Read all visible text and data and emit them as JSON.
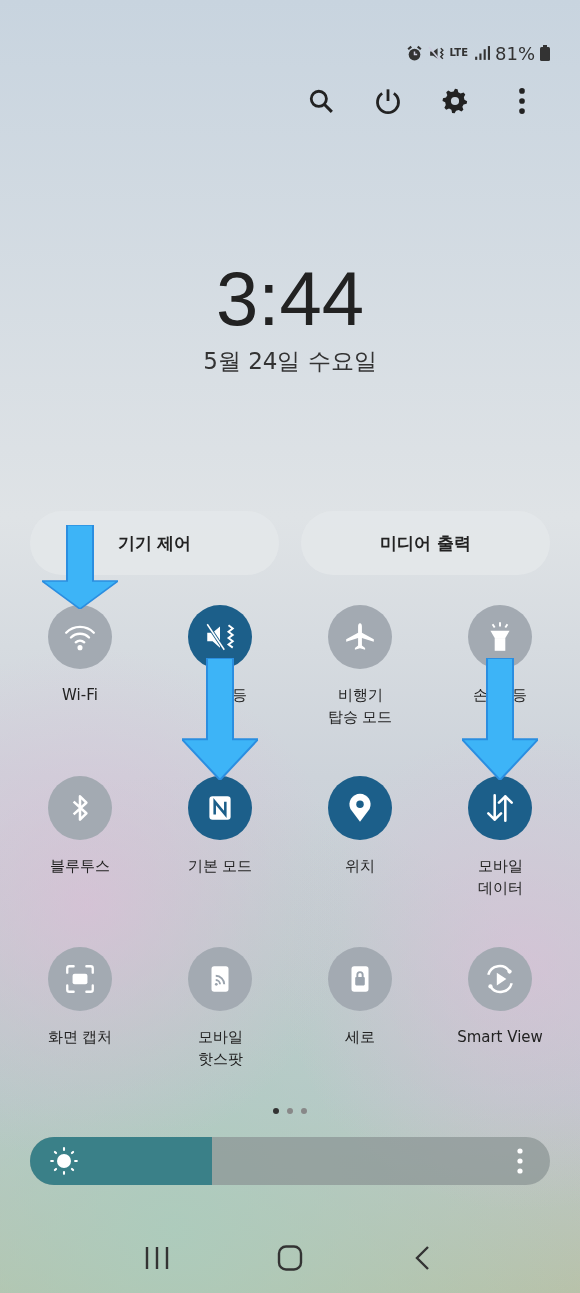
{
  "status_bar": {
    "network": "LTE",
    "battery": "81%"
  },
  "clock": {
    "time": "3:44",
    "date": "5월 24일 수요일"
  },
  "panel_buttons": [
    {
      "label": "기기 제어"
    },
    {
      "label": "미디어 출력"
    }
  ],
  "tiles": [
    {
      "label_lines": [
        "Wi-Fi"
      ],
      "on": false,
      "arrow_marked": true
    },
    {
      "fragments": [
        "등"
      ],
      "on": true,
      "arrow_marked": false
    },
    {
      "label_lines": [
        "비행기",
        "탑승 모드"
      ],
      "on": false,
      "arrow_marked": false
    },
    {
      "fragments": [
        "손",
        "등"
      ],
      "on": false,
      "arrow_marked": false
    },
    {
      "label_lines": [
        "블루투스"
      ],
      "on": false,
      "arrow_marked": false
    },
    {
      "label_lines": [
        "기본 모드"
      ],
      "on": true,
      "arrow_marked": true
    },
    {
      "label_lines": [
        "위치"
      ],
      "on": true,
      "arrow_marked": false
    },
    {
      "label_lines": [
        "모바일",
        "데이터"
      ],
      "on": true,
      "arrow_marked": true
    },
    {
      "label_lines": [
        "화면 캡처"
      ],
      "on": false,
      "arrow_marked": false
    },
    {
      "label_lines": [
        "모바일",
        "핫스팟"
      ],
      "on": false,
      "arrow_marked": false
    },
    {
      "label_lines": [
        "세로"
      ],
      "on": false,
      "arrow_marked": false
    },
    {
      "label_lines": [
        "Smart View"
      ],
      "on": false,
      "arrow_marked": false
    }
  ],
  "pages": [
    {
      "selected": true
    },
    {
      "selected": false
    },
    {
      "selected": false
    }
  ],
  "brightness": {
    "level": 0.35
  }
}
